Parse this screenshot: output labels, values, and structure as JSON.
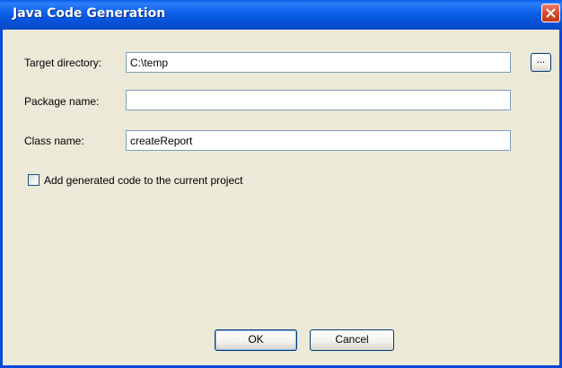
{
  "dialog": {
    "title": "Java Code Generation"
  },
  "fields": {
    "target_directory": {
      "label": "Target directory:",
      "value": "C:\\temp",
      "browse_label": "..."
    },
    "package_name": {
      "label": "Package name:",
      "value": ""
    },
    "class_name": {
      "label": "Class name:",
      "value": "createReport"
    }
  },
  "options": {
    "add_to_project_label": "Add generated code to the current project",
    "add_to_project_checked": false
  },
  "buttons": {
    "ok_label": "OK",
    "cancel_label": "Cancel"
  },
  "icons": {
    "close": "close-icon",
    "checkbox": "checkbox-unchecked-icon"
  },
  "colors": {
    "titlebar": "#0a5ee8",
    "close_button": "#d94a2a",
    "dialog_background": "#ece9d8",
    "field_border": "#7f9db9"
  }
}
